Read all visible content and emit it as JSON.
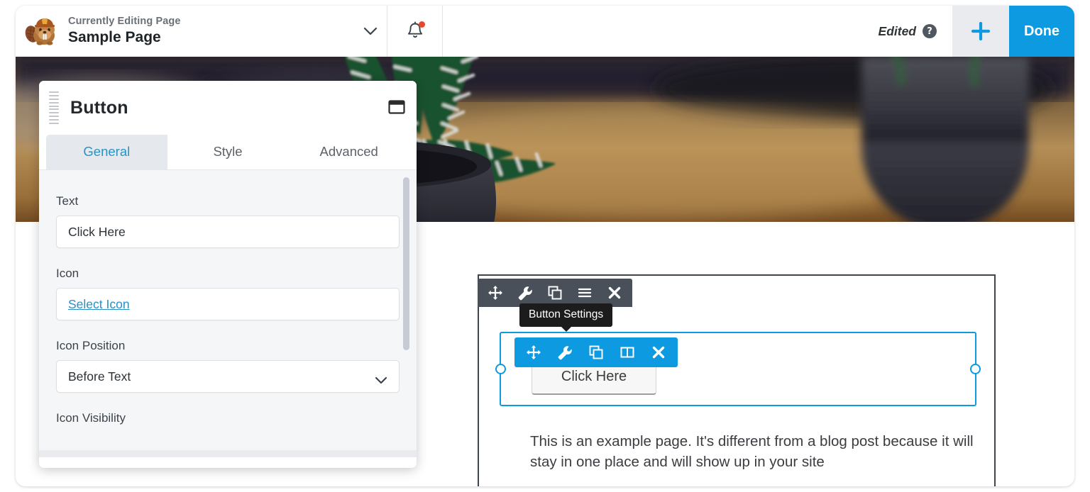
{
  "topbar": {
    "logo_icon": "beaver-logo-icon",
    "eyebrow": "Currently Editing Page",
    "page_title": "Sample Page",
    "caret_icon": "chevron-down-icon",
    "bell_icon": "bell-icon",
    "notification_dot": true,
    "edited_label": "Edited",
    "help_icon": "help-circle-icon",
    "help_glyph": "?",
    "add_icon": "plus-icon",
    "done_label": "Done",
    "accent_color": "#0e9ae0",
    "add_bg_color": "#e9ebee",
    "dot_color": "#e8472c"
  },
  "panel": {
    "grip_icon": "drag-grip-icon",
    "title": "Button",
    "window_icon": "restore-window-icon",
    "tabs": [
      {
        "label": "General",
        "active": true
      },
      {
        "label": "Style",
        "active": false
      },
      {
        "label": "Advanced",
        "active": false
      }
    ],
    "active_tab_color": "#2a93c4",
    "fields": [
      {
        "label": "Text",
        "value": "Click Here",
        "type": "text"
      },
      {
        "label": "Icon",
        "value": "Select Icon",
        "type": "link"
      },
      {
        "label": "Icon Position",
        "value": "Before Text",
        "type": "select",
        "caret_icon": "chevron-down-icon"
      },
      {
        "label": "Icon Visibility",
        "value": "",
        "type": "label-only"
      }
    ]
  },
  "canvas": {
    "dark_toolbar": {
      "bg_color": "#4a505a",
      "icons": [
        "move-icon",
        "wrench-icon",
        "duplicate-icon",
        "hamburger-icon",
        "close-icon"
      ]
    },
    "tooltip": "Button Settings",
    "blue_toolbar": {
      "bg_color": "#0e9ae0",
      "icons": [
        "move-icon",
        "wrench-icon",
        "duplicate-icon",
        "columns-icon",
        "close-icon"
      ]
    },
    "selection_color": "#0e9ae0",
    "row_outline_color": "#3f454d",
    "preview_button_label": "Click Here",
    "body_copy": "This is an example page. It's different from a blog post because it will stay in one place and will show up in your site",
    "hero_alt": "potted zebra haworthia plants on a wooden table"
  }
}
